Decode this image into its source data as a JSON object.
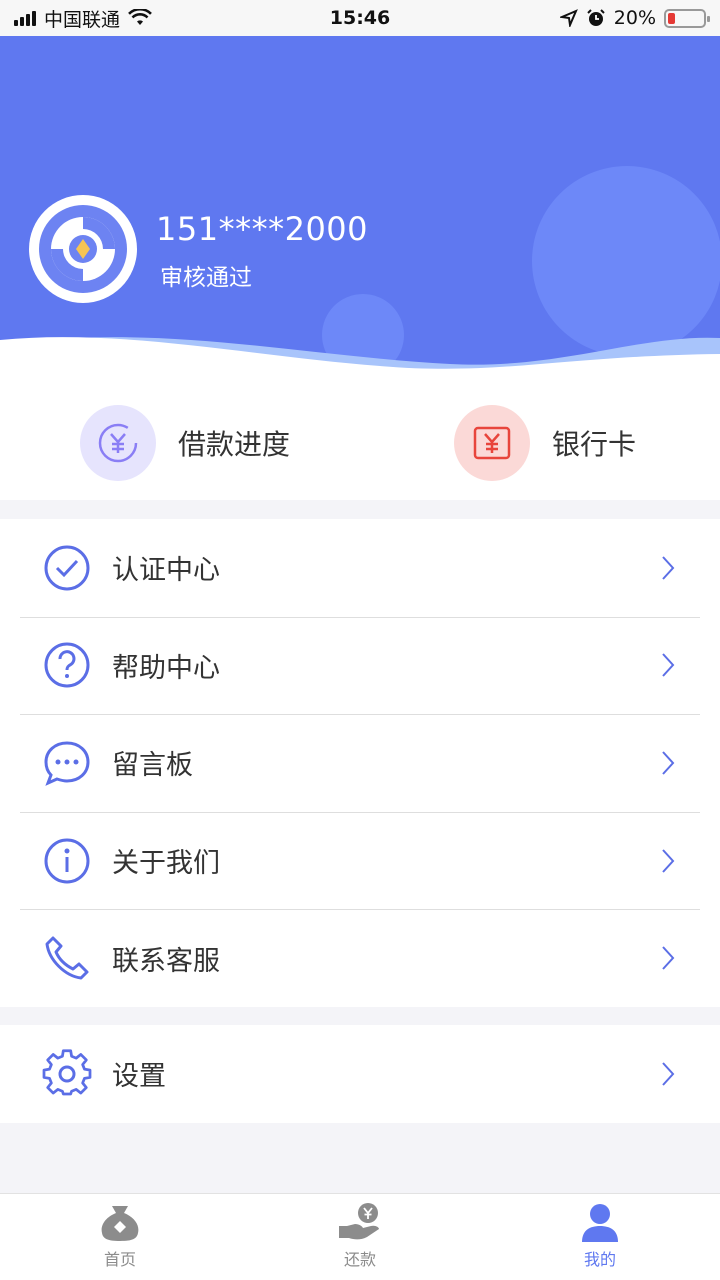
{
  "status_bar": {
    "carrier": "中国联通",
    "time": "15:46",
    "battery": "20%",
    "battery_level": 0.2
  },
  "profile": {
    "phone": "151****2000",
    "status": "审核通过"
  },
  "quick_actions": [
    {
      "label": "借款进度",
      "icon": "yuan-clock-icon",
      "color": "#8a7ef5"
    },
    {
      "label": "银行卡",
      "icon": "yuan-card-icon",
      "color": "#e8453c"
    }
  ],
  "menu": [
    {
      "label": "认证中心",
      "icon": "check-circle-icon"
    },
    {
      "label": "帮助中心",
      "icon": "question-circle-icon"
    },
    {
      "label": "留言板",
      "icon": "chat-bubble-icon"
    },
    {
      "label": "关于我们",
      "icon": "info-circle-icon"
    },
    {
      "label": "联系客服",
      "icon": "phone-icon"
    }
  ],
  "settings": {
    "label": "设置",
    "icon": "gear-icon"
  },
  "tabs": [
    {
      "label": "首页",
      "icon": "money-bag-icon",
      "active": false
    },
    {
      "label": "还款",
      "icon": "hand-coin-icon",
      "active": false
    },
    {
      "label": "我的",
      "icon": "user-icon",
      "active": true
    }
  ],
  "colors": {
    "brand": "#5f78f0",
    "icon_blue": "#5b6ee6",
    "inactive_tab": "#8c8c8c"
  }
}
